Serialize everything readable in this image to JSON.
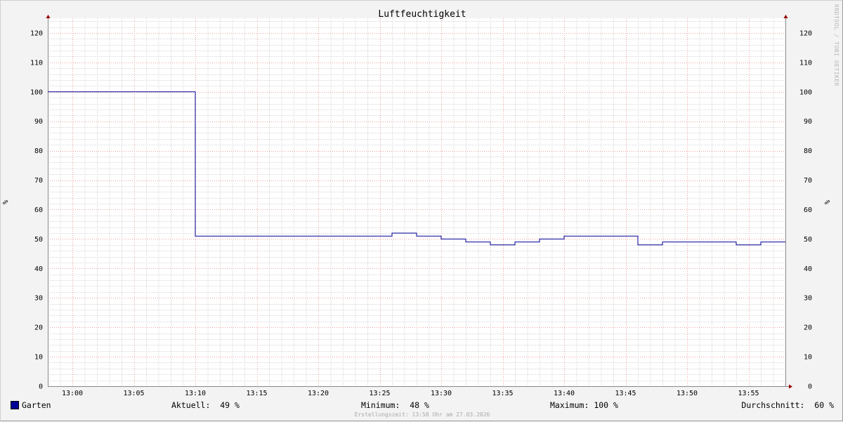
{
  "chart_data": {
    "type": "line",
    "title": "Luftfeuchtigkeit",
    "ylabel": "%",
    "ylim": [
      0,
      125
    ],
    "yticks": [
      0,
      10,
      20,
      30,
      40,
      50,
      60,
      70,
      80,
      90,
      100,
      110,
      120
    ],
    "xlim": [
      "12:58",
      "13:58"
    ],
    "xticks": [
      "13:00",
      "13:05",
      "13:10",
      "13:15",
      "13:20",
      "13:25",
      "13:30",
      "13:35",
      "13:40",
      "13:45",
      "13:50",
      "13:55"
    ],
    "grid": true,
    "legend_position": "bottom",
    "series": [
      {
        "name": "Garten",
        "color": "#000096",
        "step": true,
        "x": [
          "12:58",
          "13:10",
          "13:26",
          "13:28",
          "13:30",
          "13:32",
          "13:34",
          "13:36",
          "13:38",
          "13:40",
          "13:46",
          "13:48",
          "13:54",
          "13:56",
          "13:58"
        ],
        "y": [
          100,
          51,
          52,
          51,
          50,
          49,
          48,
          49,
          50,
          51,
          48,
          49,
          48,
          49,
          49
        ]
      }
    ]
  },
  "legend": {
    "series_name": "Garten",
    "current_label": "Aktuell:",
    "current_value": "49 %",
    "min_label": "Minimum:",
    "min_value": "48 %",
    "max_label": "Maximum:",
    "max_value": "100 %",
    "avg_label": "Durchschnitt:",
    "avg_value": "60 %"
  },
  "watermark": "RRDTOOL / TOBI OETIKER",
  "footer": "Erstellungszeit: 13:58 Uhr am 27.03.2026",
  "colors": {
    "background": "#f3f3f3",
    "plot_background": "#ffffff",
    "major_grid": "#f0a0a0",
    "minor_grid": "#d8d8d8",
    "axis": "#888888",
    "arrow": "#990000",
    "line": "#000096"
  }
}
